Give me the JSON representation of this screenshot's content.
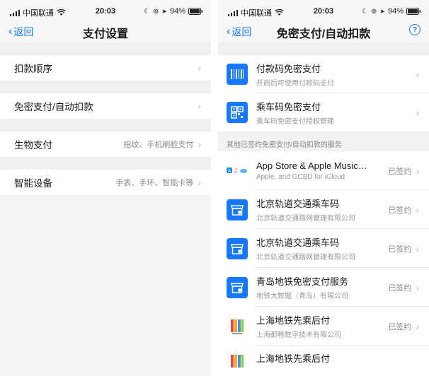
{
  "status_bar": {
    "carrier": "中国联通",
    "time": "20:03",
    "battery": "94%"
  },
  "left": {
    "nav": {
      "back_label": "返回",
      "title": "支付设置"
    },
    "menu": [
      {
        "label": "扣款顺序",
        "value": ""
      },
      {
        "label": "免密支付/自动扣款",
        "value": ""
      },
      {
        "label": "生物支付",
        "value": "指纹、手机刷脸支付"
      },
      {
        "label": "智能设备",
        "value": "手表、手环、智能卡等"
      }
    ]
  },
  "right": {
    "nav": {
      "back_label": "返回",
      "title": "免密支付/自动扣款",
      "help": "?"
    },
    "pay_codes": [
      {
        "title": "付款码免密支付",
        "subtitle": "开启后可使用付款码支付",
        "icon": "barcode-icon"
      },
      {
        "title": "乘车码免密支付",
        "subtitle": "乘车码免密支付授权管理",
        "icon": "qrcode-icon"
      }
    ],
    "section_title": "其他已签约免密支付/自动扣款的服务",
    "services": [
      {
        "title": "App Store & Apple Music…",
        "subtitle": "Apple, and GCBD for iCloud",
        "status": "已签约",
        "icon": "apple-services-icon"
      },
      {
        "title": "北京轨道交通乘车码",
        "subtitle": "北京轨道交通路网管理有限公司",
        "status": "已签约",
        "icon": "metro-shop-icon"
      },
      {
        "title": "北京轨道交通乘车码",
        "subtitle": "北京轨道交通路网管理有限公司",
        "status": "已签约",
        "icon": "metro-shop-icon"
      },
      {
        "title": "青岛地铁免密支付服务",
        "subtitle": "地铁大数据（青岛）有限公司",
        "status": "已签约",
        "icon": "metro-shop-icon"
      },
      {
        "title": "上海地铁先乘后付",
        "subtitle": "上海都畅数字技术有限公司",
        "status": "已签约",
        "icon": "metro-bars-icon"
      },
      {
        "title": "上海地铁先乘后付",
        "subtitle": "",
        "status": "",
        "icon": "metro-bars-icon"
      }
    ]
  },
  "colors": {
    "accent": "#1677ff",
    "background": "#f5f5f5"
  }
}
